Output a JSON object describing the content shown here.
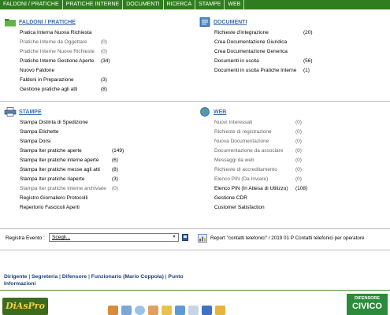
{
  "nav": {
    "tabs": [
      "FALDONI / PRATICHE",
      "PRATICHE INTERNE",
      "DOCUMENTI",
      "RICERCA",
      "STAMPE",
      "WEB"
    ]
  },
  "faldoni": {
    "title": "FALDONI / PRATICHE",
    "items": [
      {
        "label": "Pratica Interna Nuova Richiesta",
        "count": "",
        "muted": false
      },
      {
        "label": "Pratiche Interne da Oggettare",
        "count": "(0)",
        "muted": true
      },
      {
        "label": "Pratiche Interne Nuove Richieste",
        "count": "(0)",
        "muted": true
      },
      {
        "label": "Pratiche Interne Gestione Aperte",
        "count": "(34)",
        "muted": false
      },
      {
        "label": "Nuovo Faldone",
        "count": "",
        "muted": false
      },
      {
        "label": "Faldoni in Preparazione",
        "count": "(3)",
        "muted": false
      },
      {
        "label": "Gestione pratiche agli atti",
        "count": "(8)",
        "muted": false
      }
    ]
  },
  "documenti": {
    "title": "DOCUMENTI",
    "items": [
      {
        "label": "Richieste d'integrazione",
        "count": "(20)",
        "muted": false
      },
      {
        "label": "Crea Documentazione Giuridica",
        "count": "",
        "muted": false
      },
      {
        "label": "Crea Documentazione Generica",
        "count": "",
        "muted": false
      },
      {
        "label": "Documenti in uscita",
        "count": "(56)",
        "muted": false
      },
      {
        "label": "Documenti in uscita Pratiche Interne",
        "count": "(1)",
        "muted": false
      }
    ]
  },
  "stampe": {
    "title": "STAMPE",
    "items": [
      {
        "label": "Stampa Distinta di Spedizione",
        "count": "",
        "muted": false
      },
      {
        "label": "Stampa Etichette",
        "count": "",
        "muted": false
      },
      {
        "label": "Stampa Dorsi",
        "count": "",
        "muted": false
      },
      {
        "label": "Stampa Iter pratiche aperte",
        "count": "(149)",
        "muted": false
      },
      {
        "label": "Stampa Iter pratiche interne aperte",
        "count": "(6)",
        "muted": false
      },
      {
        "label": "Stampa Iter pratiche messe agli atti",
        "count": "(8)",
        "muted": false
      },
      {
        "label": "Stampa Iter pratiche riaperte",
        "count": "(3)",
        "muted": false
      },
      {
        "label": "Stampa Iter pratiche interne archiviate",
        "count": "(0)",
        "muted": true
      },
      {
        "label": "Registro Giornaliero Protocolli",
        "count": "",
        "muted": false
      },
      {
        "label": "Repertorio Fascicoli Aperti",
        "count": "",
        "muted": false
      }
    ]
  },
  "web": {
    "title": "WEB",
    "items": [
      {
        "label": "Nuovi Interessati",
        "count": "(0)",
        "muted": true
      },
      {
        "label": "Richieste di registrazione",
        "count": "(0)",
        "muted": true
      },
      {
        "label": "Nuova Documentazione",
        "count": "(0)",
        "muted": true
      },
      {
        "label": "Documentazione da associare",
        "count": "(0)",
        "muted": true
      },
      {
        "label": "Messaggi da web",
        "count": "(0)",
        "muted": true
      },
      {
        "label": "Richieste di accreditamento",
        "count": "(0)",
        "muted": true
      },
      {
        "label": "Elenco PIN (Da Inviare)",
        "count": "(0)",
        "muted": true
      },
      {
        "label": "Elenco PIN (In Attesa di Utilizzo)",
        "count": "(108)",
        "muted": false
      },
      {
        "label": "Gestione CDR",
        "count": "",
        "muted": false
      },
      {
        "label": "Customer Satisfaction",
        "count": "",
        "muted": false
      }
    ]
  },
  "evento": {
    "label": "Registra Evento :",
    "selected": "Scegli..."
  },
  "report": {
    "text": "Report \"contatti telefonici\" / 2019 01 P Contatti telefonici per operatore"
  },
  "footer": {
    "links": [
      "Dirigente",
      "Segreteria",
      "Difensore",
      "Funzionario (Mario Coppola)",
      "Punto Informazioni"
    ],
    "separator": "|"
  },
  "logos": {
    "left": "DiAsPro",
    "right_line1": "DIFENSORE",
    "right_line2": "CIVICO"
  },
  "colors": {
    "nav_bg": "#2f7d1e",
    "section_title": "#3f6fb0",
    "link_blue": "#1c3d7a",
    "muted_text": "#666666"
  },
  "toolbar_icons": [
    "house-icon",
    "mail-icon",
    "search-icon",
    "user-icon",
    "folder-icon",
    "folder-icon",
    "document-icon",
    "calendar-icon",
    "people-icon"
  ]
}
